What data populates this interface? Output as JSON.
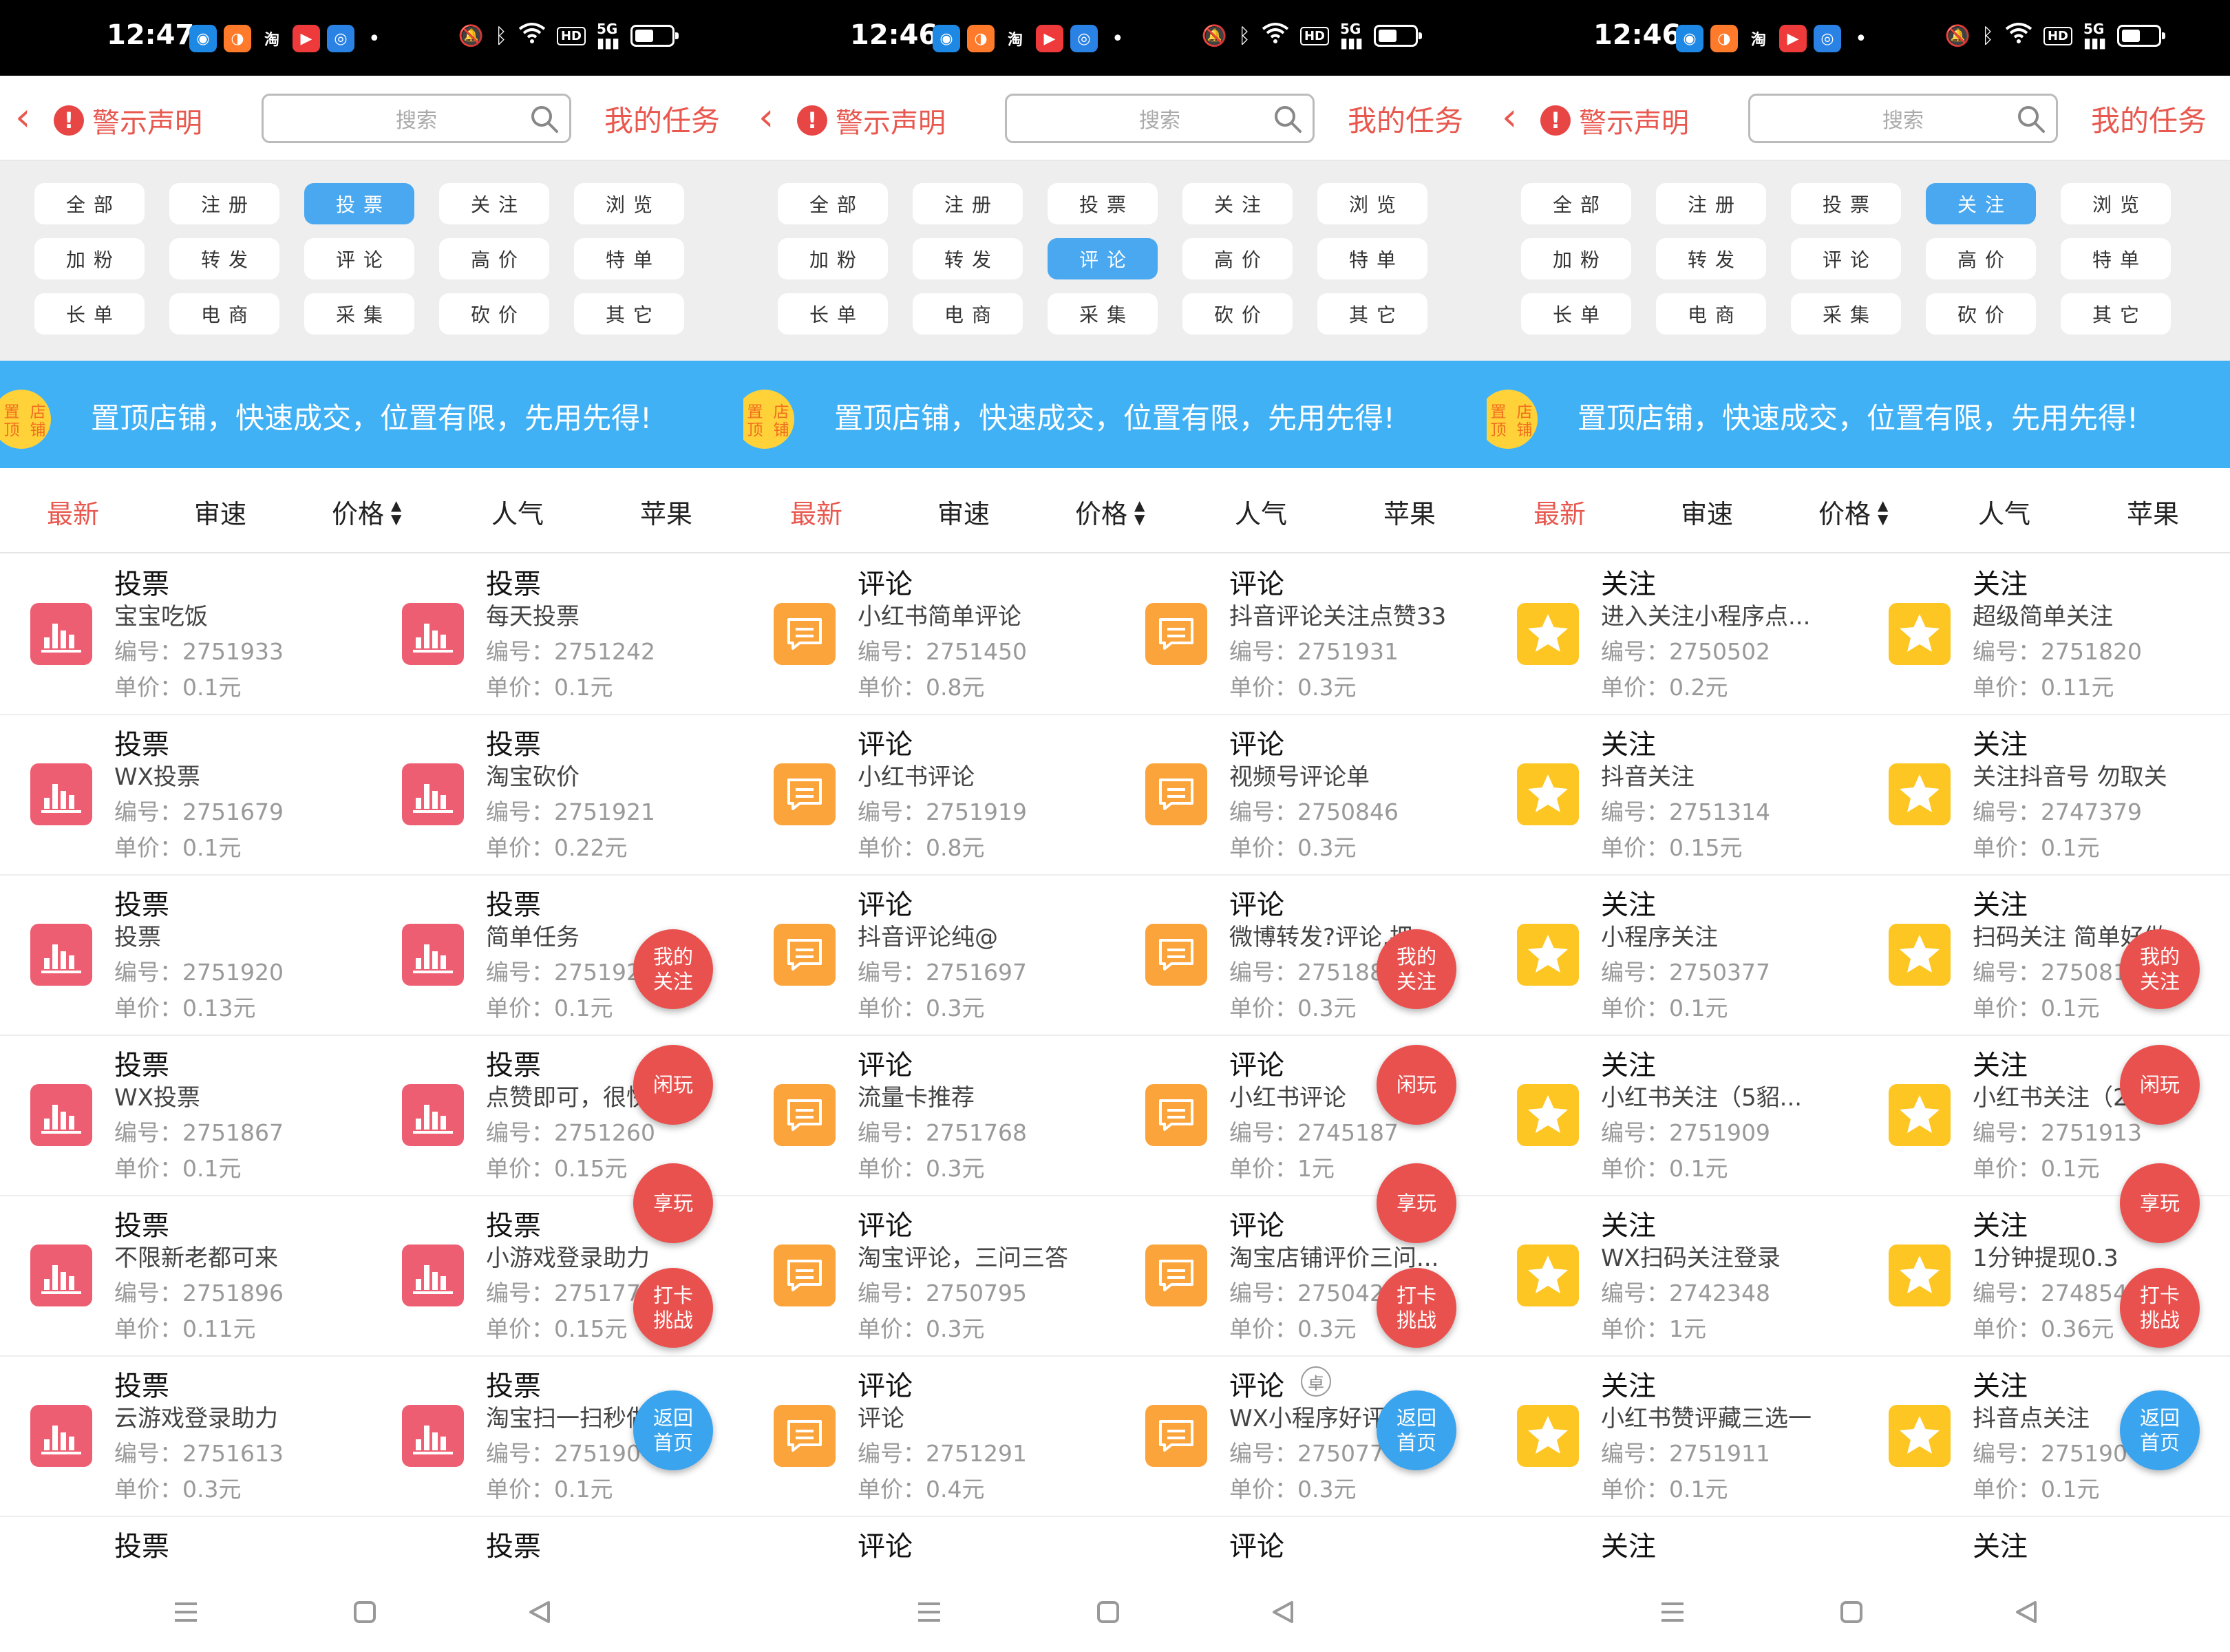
{
  "colors": {
    "accent_red": "#e8584f",
    "active_blue": "#4aa8f0",
    "banner_blue": "#41b1f5",
    "vote_icon": "#ee5e72",
    "comment_icon": "#fba43b",
    "follow_icon": "#fdc623",
    "fab_red": "#e9514e",
    "fab_blue": "#3aa4ef"
  },
  "common": {
    "header": {
      "warning_label": "警示声明",
      "search_placeholder": "搜索",
      "my_tasks": "我的任务"
    },
    "categories": [
      "全部",
      "注册",
      "投票",
      "关注",
      "浏览",
      "加粉",
      "转发",
      "评论",
      "高价",
      "特单",
      "长单",
      "电商",
      "采集",
      "砍价",
      "其它"
    ],
    "banner": {
      "badge_line1": "置顶",
      "badge_line2": "店铺",
      "text": "置顶店铺，快速成交，位置有限，先用先得!"
    },
    "sort": [
      "最新",
      "审速",
      "价格",
      "人气",
      "苹果"
    ],
    "fabs": [
      {
        "line1": "我的",
        "line2": "关注"
      },
      {
        "line1": "闲玩",
        "line2": ""
      },
      {
        "line1": "享玩",
        "line2": ""
      },
      {
        "line1": "打卡",
        "line2": "挑战"
      },
      {
        "line1": "返回",
        "line2": "首页"
      }
    ]
  },
  "panels": [
    {
      "time": "12:47",
      "active_category": 2,
      "icon": "chart-bars-icon",
      "type": "投票",
      "tasks": [
        {
          "title": "宝宝吃饭",
          "id": "编号：2751933",
          "price": "单价：0.1元"
        },
        {
          "title": "每天投票",
          "id": "编号：2751242",
          "price": "单价：0.1元"
        },
        {
          "title": "WX投票",
          "id": "编号：2751679",
          "price": "单价：0.1元"
        },
        {
          "title": "淘宝砍价",
          "id": "编号：2751921",
          "price": "单价：0.22元"
        },
        {
          "title": "投票",
          "id": "编号：2751920",
          "price": "单价：0.13元"
        },
        {
          "title": "简单任务",
          "id": "编号：275192",
          "price": "单价：0.1元"
        },
        {
          "title": "WX投票",
          "id": "编号：2751867",
          "price": "单价：0.1元"
        },
        {
          "title": "点赞即可，很快",
          "id": "编号：2751260",
          "price": "单价：0.15元"
        },
        {
          "title": "不限新老都可来",
          "id": "编号：2751896",
          "price": "单价：0.11元"
        },
        {
          "title": "小游戏登录助力",
          "id": "编号：2751773",
          "price": "单价：0.15元"
        },
        {
          "title": "云游戏登录助力",
          "id": "编号：2751613",
          "price": "单价：0.3元"
        },
        {
          "title": "淘宝扫一扫秒做",
          "id": "编号：275190",
          "price": "单价：0.1元"
        }
      ]
    },
    {
      "time": "12:46",
      "active_category": 7,
      "icon": "message-box-icon",
      "type": "评论",
      "tasks": [
        {
          "title": "小红书简单评论",
          "id": "编号：2751450",
          "price": "单价：0.8元"
        },
        {
          "title": "抖音评论关注点赞33",
          "id": "编号：2751931",
          "price": "单价：0.3元"
        },
        {
          "title": "小红书评论",
          "id": "编号：2751919",
          "price": "单价：0.8元"
        },
        {
          "title": "视频号评论单",
          "id": "编号：2750846",
          "price": "单价：0.3元"
        },
        {
          "title": "抖音评论纯@",
          "id": "编号：2751697",
          "price": "单价：0.3元"
        },
        {
          "title": "微博转发?评论,把",
          "id": "编号：275188",
          "price": "单价：0.3元"
        },
        {
          "title": "流量卡推荐",
          "id": "编号：2751768",
          "price": "单价：0.3元"
        },
        {
          "title": "小红书评论",
          "id": "编号：2745187",
          "price": "单价：1元"
        },
        {
          "title": "淘宝评论，三问三答",
          "id": "编号：2750795",
          "price": "单价：0.3元"
        },
        {
          "title": "淘宝店铺评价三问...",
          "id": "编号：275042",
          "price": "单价：0.3元"
        },
        {
          "title": "评论",
          "id": "编号：2751291",
          "price": "单价：0.4元"
        },
        {
          "title": "WX小程序好评",
          "id": "编号：275077",
          "price": "单价：0.3元",
          "badge": "卓"
        }
      ]
    },
    {
      "time": "12:46",
      "active_category": 3,
      "icon": "star-icon",
      "type": "关注",
      "tasks": [
        {
          "title": "进入关注小程序点...",
          "id": "编号：2750502",
          "price": "单价：0.2元"
        },
        {
          "title": "超级简单关注",
          "id": "编号：2751820",
          "price": "单价：0.11元"
        },
        {
          "title": "抖音关注",
          "id": "编号：2751314",
          "price": "单价：0.15元"
        },
        {
          "title": "关注抖音号 勿取关",
          "id": "编号：2747379",
          "price": "单价：0.1元"
        },
        {
          "title": "小程序关注",
          "id": "编号：2750377",
          "price": "单价：0.1元"
        },
        {
          "title": "扫码关注 简单好做",
          "id": "编号：275081",
          "price": "单价：0.1元"
        },
        {
          "title": "小红书关注（5貂...",
          "id": "编号：2751909",
          "price": "单价：0.1元"
        },
        {
          "title": "小红书关注（2",
          "id": "编号：2751913",
          "price": "单价：0.1元"
        },
        {
          "title": "WX扫码关注登录",
          "id": "编号：2742348",
          "price": "单价：1元"
        },
        {
          "title": "1分钟提现0.3",
          "id": "编号：274854",
          "price": "单价：0.36元"
        },
        {
          "title": "小红书赞评藏三选一",
          "id": "编号：2751911",
          "price": "单价：0.1元"
        },
        {
          "title": "抖音点关注",
          "id": "编号：275190",
          "price": "单价：0.1元"
        }
      ]
    }
  ]
}
